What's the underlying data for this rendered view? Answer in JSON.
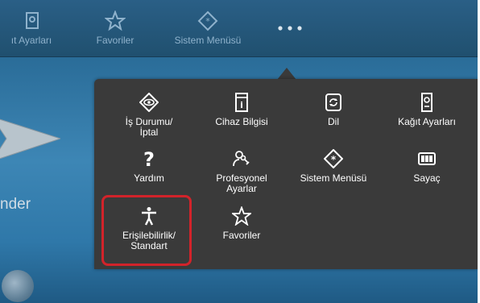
{
  "topbar": {
    "items": [
      {
        "label": "ıt Ayarları",
        "icon": "paper-settings-icon"
      },
      {
        "label": "Favoriler",
        "icon": "star-icon"
      },
      {
        "label": "Sistem Menüsü",
        "icon": "system-menu-icon"
      }
    ],
    "more_icon": "more-dots-icon"
  },
  "background": {
    "left_text": "nder"
  },
  "popup": {
    "items": [
      {
        "label": "İş Durumu/\nİptal",
        "icon": "eye-icon"
      },
      {
        "label": "Cihaz Bilgisi",
        "icon": "device-info-icon"
      },
      {
        "label": "Dil",
        "icon": "language-icon"
      },
      {
        "label": "Kağıt Ayarları",
        "icon": "paper-settings-icon"
      },
      {
        "label": "Yardım",
        "icon": "help-icon"
      },
      {
        "label": "Profesyonel\nAyarlar",
        "icon": "professional-settings-icon"
      },
      {
        "label": "Sistem Menüsü",
        "icon": "system-menu-icon"
      },
      {
        "label": "Sayaç",
        "icon": "counter-icon"
      },
      {
        "label": "Erişilebilirlik/\nStandart",
        "icon": "accessibility-icon"
      },
      {
        "label": "Favoriler",
        "icon": "star-icon"
      }
    ]
  },
  "colors": {
    "popup_bg": "#3a3a3a",
    "highlight": "#d2232a",
    "topbar_text": "#8fb2cc"
  }
}
